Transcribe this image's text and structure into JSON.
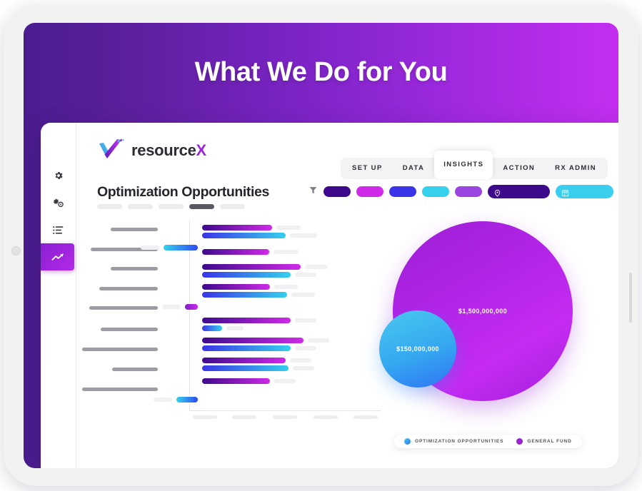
{
  "slide": {
    "headline": "What We Do for You",
    "background_gradient_from": "#4a1d8f",
    "background_gradient_to": "#c42ef0"
  },
  "app": {
    "logo": {
      "name": "resource",
      "accent_letter": "X",
      "mark_icon": "check-swoosh-logo-icon",
      "accent_color": "#9a28d8"
    },
    "tabs": [
      {
        "label": "SET UP",
        "active": false
      },
      {
        "label": "DATA",
        "active": false
      },
      {
        "label": "INSIGHTS",
        "active": true
      },
      {
        "label": "ACTION",
        "active": false
      },
      {
        "label": "RX ADMIN",
        "active": false
      }
    ],
    "page_title": "Optimization Opportunities",
    "sidebar": {
      "items": [
        {
          "icon": "gear-icon",
          "active": false
        },
        {
          "icon": "double-gears-icon",
          "active": false
        },
        {
          "icon": "list-icon",
          "active": false
        },
        {
          "icon": "trend-chart-icon",
          "active": true
        }
      ]
    },
    "filters": {
      "funnel_icon": "filter-funnel-icon",
      "search_icon": "search-icon",
      "chips": [
        {
          "color": "#3d0a8c"
        },
        {
          "color": "#cf2ae8"
        },
        {
          "color": "#3a34e8"
        },
        {
          "color": "#34d0ec"
        },
        {
          "color": "#9b45e0"
        }
      ],
      "wide_chips": [
        {
          "color": "#3d0a8c",
          "icon": "location-pin-icon"
        },
        {
          "color": "#39cdee",
          "icon": "calendar-grid-icon"
        }
      ]
    },
    "sub_filters": [
      {
        "active": false
      },
      {
        "active": false
      },
      {
        "active": false
      },
      {
        "active": true
      },
      {
        "active": false
      }
    ]
  },
  "chart_data": [
    {
      "type": "bar",
      "title": "Optimization Opportunities",
      "orientation": "horizontal",
      "xlabel": "",
      "ylabel": "",
      "grid": false,
      "legend": "none",
      "note": "Redacted/skeleton bar chart — category labels and tick labels rendered as gray placeholder bars",
      "categories": [
        "label-1",
        "label-2",
        "label-3",
        "label-4",
        "label-5",
        "label-6",
        "label-7",
        "label-8",
        "label-9"
      ],
      "series": [
        {
          "name": "Purple series",
          "color_from": "#3d0a8c",
          "color_to": "#cf2ae8",
          "values": [
            60,
            58,
            83,
            70,
            5,
            72,
            86,
            66,
            58
          ]
        },
        {
          "name": "Blue series",
          "color_from": "#3a34e8",
          "color_to": "#34d0ec",
          "values": [
            72,
            0,
            74,
            76,
            0,
            16,
            75,
            73,
            0
          ]
        }
      ],
      "tick_labels": [
        "tick-1",
        "tick-2",
        "tick-3",
        "tick-4",
        "tick-5"
      ]
    },
    {
      "type": "bubble",
      "title": "",
      "legend_position": "bottom-left",
      "points": [
        {
          "label": "$1,500,000,000",
          "value": 1500000000,
          "series": "GENERAL FUND",
          "color_from": "#9b1fd4",
          "color_to": "#c52bf2"
        },
        {
          "label": "$150,000,000",
          "value": 150000000,
          "series": "OPTIMIZATION OPPORTUNITIES",
          "color_from": "#4ac8ef",
          "color_to": "#2f74f5"
        }
      ],
      "legend": [
        {
          "label": "OPTIMIZATION OPPORTUNITIES",
          "color": "#2f8df2"
        },
        {
          "label": "GENERAL FUND",
          "color": "#9b22d8"
        }
      ]
    }
  ]
}
